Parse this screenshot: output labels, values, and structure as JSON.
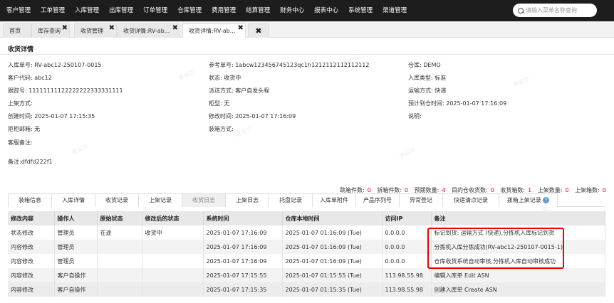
{
  "nav": {
    "items": [
      "客户管理",
      "工单管理",
      "入库管理",
      "出库管理",
      "订单管理",
      "仓库管理",
      "费用管理",
      "结算管理",
      "财务中心",
      "报表中心",
      "系统管理",
      "渠道管理"
    ],
    "search_placeholder": "请输入菜单名称查询"
  },
  "tabs": [
    {
      "label": "首页",
      "closable": false,
      "active": false
    },
    {
      "label": "库存查询",
      "closable": true,
      "active": false
    },
    {
      "label": "收货管理",
      "closable": true,
      "active": false
    },
    {
      "label": "收货详情:RV-ab...",
      "closable": true,
      "active": false
    },
    {
      "label": "收货详情:RV-ab...",
      "closable": true,
      "active": true
    },
    {
      "label": "",
      "closable": true,
      "active": false
    }
  ],
  "detail": {
    "title": "收货详情",
    "fields": {
      "inbound_no": {
        "label": "入库单号:",
        "value": "RV-abc12-250107-0015"
      },
      "ref_no": {
        "label": "参考单号:",
        "value": "1abcw123456745123qc1h1212112112112112"
      },
      "warehouse": {
        "label": "仓库:",
        "value": "DEMO"
      },
      "customer_code": {
        "label": "客户代码:",
        "value": "abc12"
      },
      "status": {
        "label": "状态:",
        "value": "收货中"
      },
      "inbound_type": {
        "label": "入库类型:",
        "value": "标准"
      },
      "tracking_no": {
        "label": "跟踪号:",
        "value": "11111111122222222333331111"
      },
      "dispatch": {
        "label": "派送方式:",
        "value": "客户自发头程"
      },
      "transport": {
        "label": "运输方式:",
        "value": "快递"
      },
      "shelf_method": {
        "label": "上架方式:",
        "value": ""
      },
      "cabinet_no": {
        "label": "柜型:",
        "value": "无"
      },
      "eta": {
        "label": "预计到仓时间:",
        "value": "2025-01-07 17:16:09"
      },
      "created": {
        "label": "创建时间:",
        "value": "2025-01-07 17:15:35"
      },
      "modified": {
        "label": "修改时间:",
        "value": "2025-01-07 17:16:09"
      },
      "desc": {
        "label": "说明:",
        "value": ""
      },
      "reject_email": {
        "label": "拒柜邮箱:",
        "value": "无"
      },
      "box_method": {
        "label": "装箱方式:",
        "value": ""
      },
      "customer_note": {
        "label": "客服备注:",
        "value": ""
      },
      "note": {
        "label": "备注:",
        "value": "dfdfd222f1"
      }
    }
  },
  "stats": [
    {
      "label": "跳箱件数:",
      "value": "0"
    },
    {
      "label": "拆箱件数:",
      "value": "0"
    },
    {
      "label": "预期数量:",
      "value": "4"
    },
    {
      "label": "目的仓收货数:",
      "value": "0"
    },
    {
      "label": "收货箱数:",
      "value": "1"
    },
    {
      "label": "上架数量:",
      "value": "0"
    },
    {
      "label": "上架箱数:",
      "value": "0"
    }
  ],
  "subtabs": [
    "装箱信息",
    "入库详情",
    "收货记录",
    "上架记录",
    "收货日志",
    "上架日志",
    "托盘记录",
    "入库单附件",
    "产品序列号",
    "异常登记",
    "快递清点记录",
    "拨箱上架记录"
  ],
  "subtabs_active": 4,
  "log_table": {
    "headers": [
      "修改内容",
      "操作人",
      "原始状态",
      "修改后的状态",
      "系统时间",
      "仓库本地时间",
      "访问IP",
      "备注"
    ],
    "rows": [
      [
        "状态修改",
        "管理员",
        "在途",
        "收货中",
        "2025-01-07 17:16:09",
        "2025-01-07 01:16:09 (Tue)",
        "0.0.0.0",
        "标记到货: 运输方式 (快递),分拣机入库标记到货"
      ],
      [
        "内容修改",
        "管理员",
        "",
        "",
        "2025-01-07 17:16:09",
        "2025-01-07 01:16:09 (Tue)",
        "0.0.0.0",
        "分拣机入库分拣成功(RV-abc12-250107-0015-1)"
      ],
      [
        "内容修改",
        "管理员",
        "",
        "",
        "2025-01-07 17:16:09",
        "2025-01-07 01:16:09 (Tue)",
        "0.0.0.0",
        "仓库收货系统自动审核,分拣机入库自动审核成功"
      ],
      [
        "内容修改",
        "客户自操作",
        "",
        "",
        "2025-01-07 17:15:55",
        "2025-01-07 01:15:55 (Tue)",
        "113.98.55.98",
        "编辑入库单 Edit ASN"
      ],
      [
        "内容修改",
        "客户自操作",
        "",
        "",
        "2025-01-07 17:15:35",
        "2025-01-07 01:15:35 (Tue)",
        "113.98.55.98",
        "创建入库单 Create ASN"
      ]
    ]
  },
  "watermark": "曹威华",
  "colors": {
    "nav_bg": "#1d1d1d",
    "highlight": "#e00000",
    "stat_number": "#e60012"
  }
}
